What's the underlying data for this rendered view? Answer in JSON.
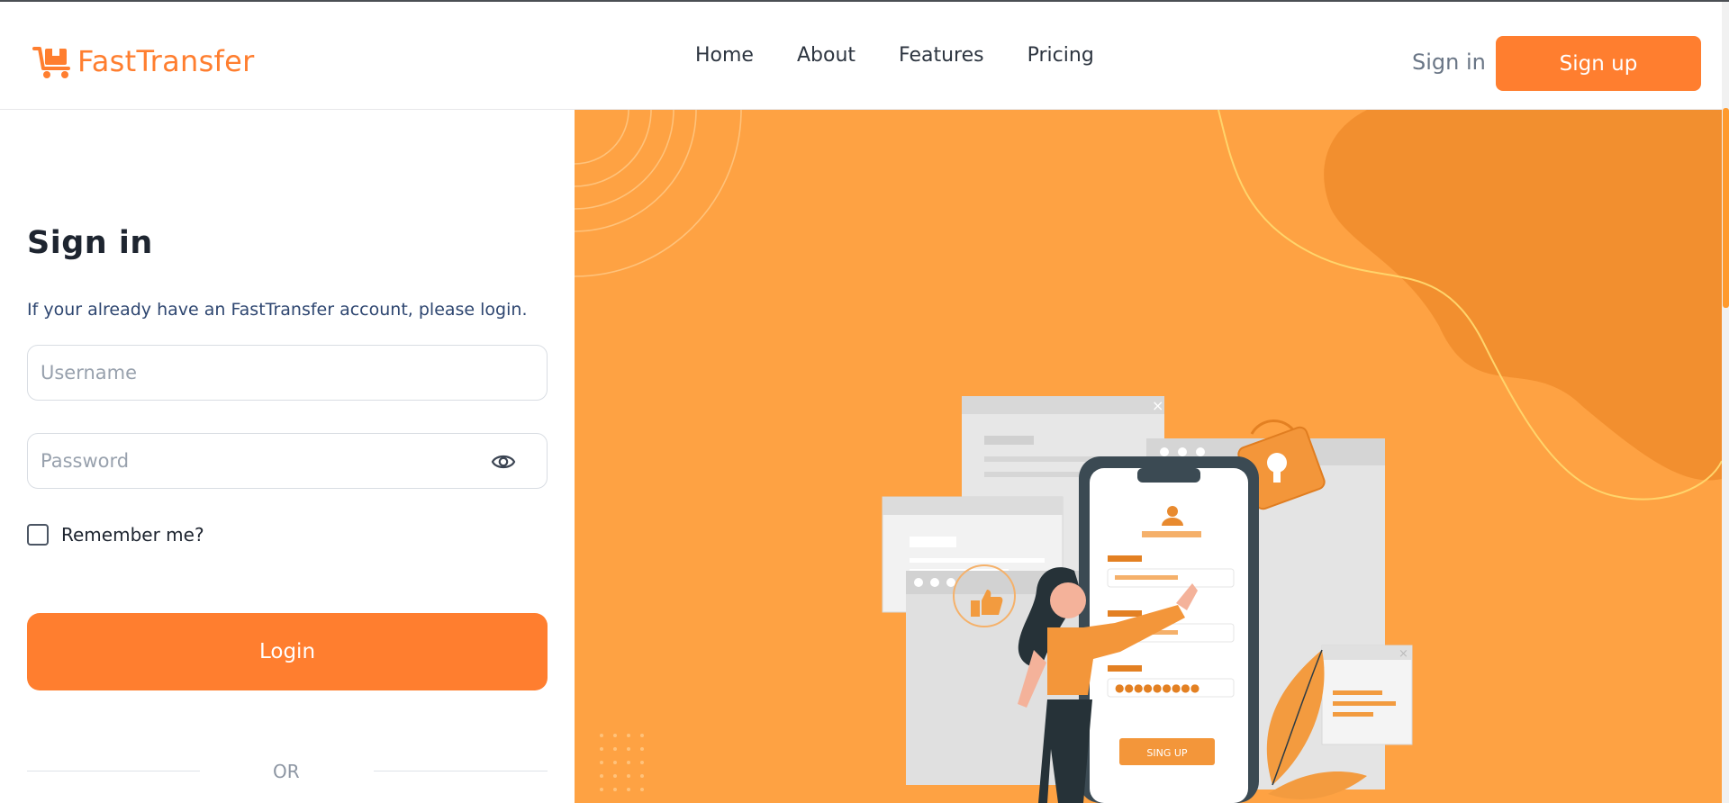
{
  "brand": {
    "name": "FastTransfer",
    "logo_icon": "cart-icon",
    "accent_color": "#ff7e2f",
    "hero_color": "#fea243"
  },
  "nav": {
    "items": [
      {
        "label": "Home"
      },
      {
        "label": "About"
      },
      {
        "label": "Features"
      },
      {
        "label": "Pricing"
      }
    ]
  },
  "auth_buttons": {
    "sign_in": "Sign in",
    "sign_up": "Sign up"
  },
  "form": {
    "title": "Sign in",
    "subtitle": "If your already have an FastTransfer account, please login.",
    "username": {
      "placeholder": "Username",
      "value": ""
    },
    "password": {
      "placeholder": "Password",
      "value": "",
      "toggle_icon": "eye-icon"
    },
    "remember_label": "Remember me?",
    "remember_checked": false,
    "login_label": "Login",
    "divider_text": "OR"
  },
  "illustration": {
    "phone_button_label": "SING UP"
  }
}
